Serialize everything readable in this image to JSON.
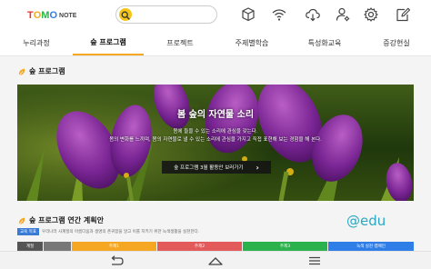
{
  "app": {
    "logo_letters": [
      "T",
      "O",
      "M",
      "O"
    ],
    "logo_letter_colors": [
      "#e8322f",
      "#f5a623",
      "#2bb24c",
      "#2f7ee8"
    ],
    "logo_suffix": "NOTE"
  },
  "search": {
    "value": "",
    "icon": "search-icon"
  },
  "top_icons": [
    "box-icon",
    "wifi-icon",
    "cloud-download-icon",
    "user-settings-icon",
    "gear-icon",
    "note-edit-icon"
  ],
  "nav": {
    "tabs": [
      {
        "label": "누리과정",
        "active": false
      },
      {
        "label": "숲 프로그램",
        "active": true
      },
      {
        "label": "프로젝트",
        "active": false
      },
      {
        "label": "주제별학습",
        "active": false
      },
      {
        "label": "특성화교육",
        "active": false
      },
      {
        "label": "증강현실",
        "active": false
      }
    ]
  },
  "section": {
    "title": "숲 프로그램"
  },
  "banner": {
    "title": "봄 숲의 자연물 소리",
    "line1": "봄에 들을 수 있는 소리에 관심을 갖는다.",
    "line2": "봄의 변화를 느끼며, 봄의 자연물로 낼 수 있는 소리에 관심을 가지고 직접 표현해 보는 경험을 해 본다.",
    "button_label": "숲 프로그램 3월 활동안 보러가기",
    "button_arrow": "›"
  },
  "plan": {
    "title": "숲 프로그램 연간 계획안",
    "badge": "교육 목표",
    "description": "우리나라 사계절의 아름다움과 생명의 존귀함을 알고 이를 지키기 위한 녹색생활을 실천한다.",
    "watermark": "@edu",
    "cells": [
      {
        "label": "계절",
        "color": "#555555"
      },
      {
        "label": "",
        "color": "#777777"
      },
      {
        "label": "주제1",
        "color": "#f5a623"
      },
      {
        "label": "주제2",
        "color": "#e25a5a"
      },
      {
        "label": "주제3",
        "color": "#2bb24c"
      },
      {
        "label": "녹색 실천 캠페인",
        "color": "#2f7ee8"
      }
    ]
  },
  "system_nav": [
    "back-icon",
    "home-icon",
    "recents-icon"
  ]
}
